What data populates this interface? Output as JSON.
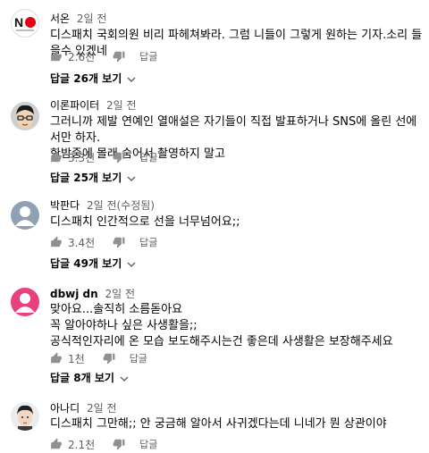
{
  "comments": [
    {
      "author": "서온",
      "time": "2일 전",
      "text": "디스패치 국회의원 비리 파헤쳐봐라. 그럼 니들이 그렇게 원하는 기자.소리 들을수 있겠네",
      "likes": "2.6천",
      "reply_label": "답글",
      "replies_label": "답글 26개 보기",
      "avatar_text": "NO"
    },
    {
      "author": "이론파이터",
      "time": "2일 전",
      "text": "그러니까 제발 연예인  열애설은 자기들이 직접 발표하거나 SNS에 올린 선에서만 하자.\n한밤중에 몰래 숨어서 촬영하지 말고",
      "likes": "3.3천",
      "reply_label": "답글",
      "replies_label": "답글 25개 보기"
    },
    {
      "author": "박판다",
      "time": "2일 전(수정됨)",
      "text": "디스패치 인간적으로 선을 너무넘어요;;",
      "likes": "3.4천",
      "reply_label": "답글",
      "replies_label": "답글 49개 보기"
    },
    {
      "author": "dbwj dn",
      "time": "2일 전",
      "text": "맞아요...솔직히 소름돋아요\n꼭 알아야하나 싶은 사생활을;;\n공식적인자리에 온 모습 보도해주시는건 좋은데 사생활은 보장해주세요",
      "likes": "1천",
      "reply_label": "답글",
      "replies_label": "답글 8개 보기"
    },
    {
      "author": "아나디",
      "time": "2일 전",
      "text": "디스패치 그만해;; 안 궁금해 알아서 사귀겠다는데 니네가 뭔 상관이야",
      "likes": "2.1천",
      "reply_label": "답글"
    }
  ],
  "colors": {
    "meta": "#606060",
    "avatar_gray": "#8fa1b2",
    "avatar_pink": "#e8417d",
    "no_red": "#e60012"
  }
}
